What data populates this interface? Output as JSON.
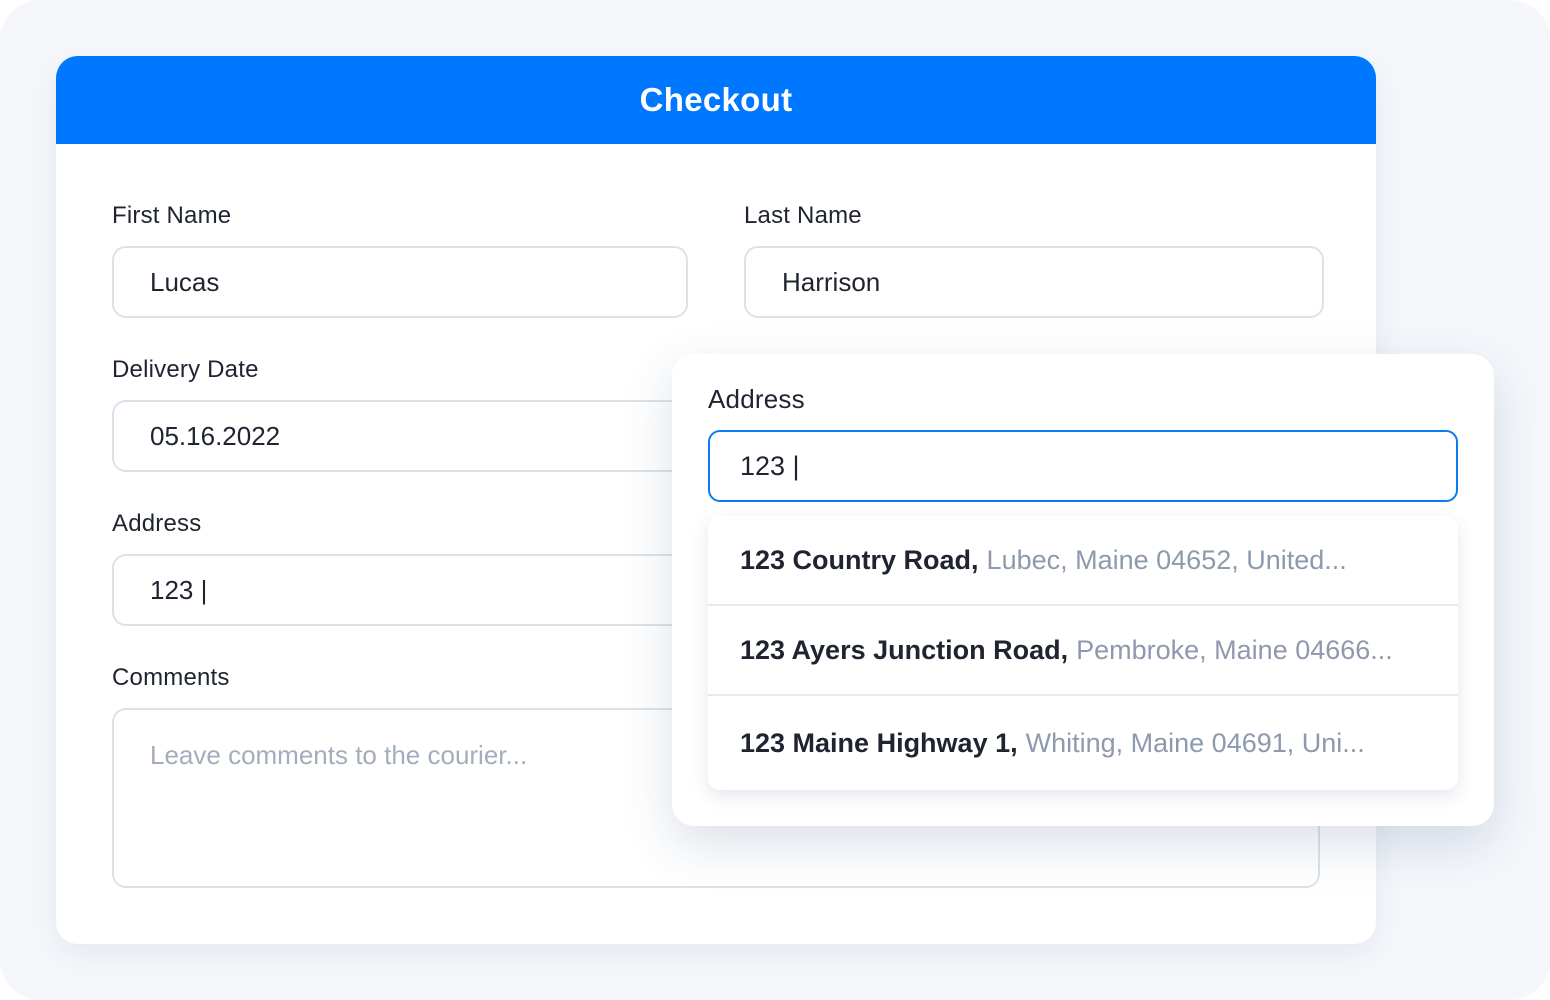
{
  "header": {
    "title": "Checkout"
  },
  "form": {
    "first_name": {
      "label": "First Name",
      "value": "Lucas"
    },
    "last_name": {
      "label": "Last Name",
      "value": "Harrison"
    },
    "delivery_date": {
      "label": "Delivery Date",
      "value": "05.16.2022"
    },
    "address": {
      "label": "Address",
      "value": "123 |"
    },
    "comments": {
      "label": "Comments",
      "placeholder": "Leave comments to the courier..."
    }
  },
  "address_popup": {
    "label": "Address",
    "value": "123 |",
    "suggestions": [
      {
        "street": "123 Country Road,",
        "rest": "Lubec, Maine 04652, United..."
      },
      {
        "street": "123 Ayers Junction Road,",
        "rest": "Pembroke, Maine 04666..."
      },
      {
        "street": "123 Maine Highway 1,",
        "rest": "Whiting, Maine 04691, Uni..."
      }
    ]
  },
  "colors": {
    "accent": "#0077ff",
    "focus_border": "#0a7cf0",
    "text": "#1f2430",
    "muted": "#8e99ad"
  }
}
